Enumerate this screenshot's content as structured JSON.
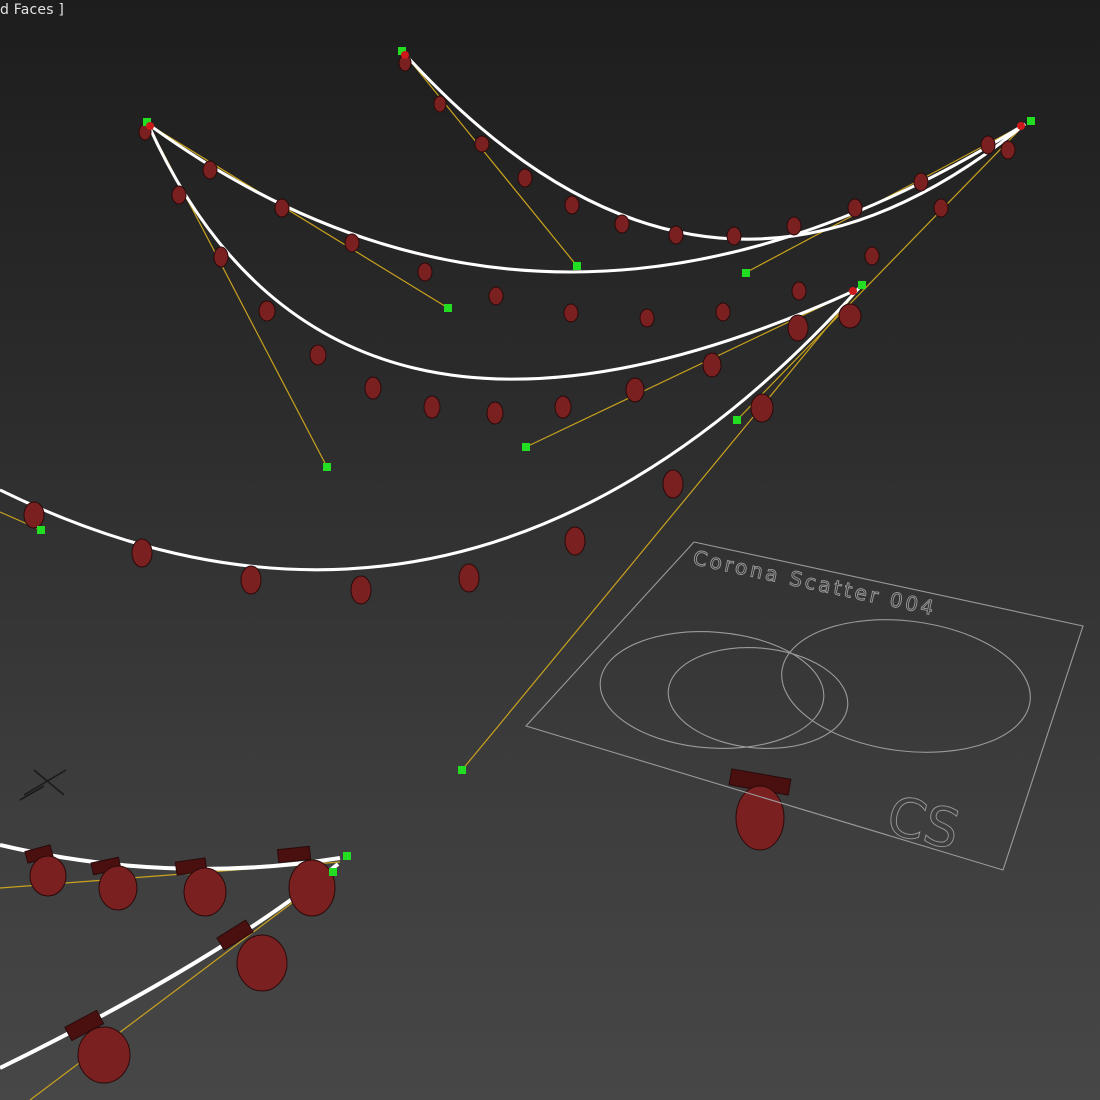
{
  "viewport": {
    "label": "d Faces ]",
    "background_top": "#1d1d1d",
    "background_bottom": "#474747"
  },
  "scatter_gizmo": {
    "name_text": "Corona Scatter 004",
    "logo_text": "CS"
  },
  "colors": {
    "wire": "#ffffff",
    "tangent": "#c8a21e",
    "handle": "#22dd22",
    "endpoint": "#cc1a1a",
    "bulb": "#7a2020",
    "gizmo": "#9a9a9a"
  },
  "icons": {
    "pivot": "pivot-cross-icon",
    "bulb": "light-bulb-icon"
  }
}
